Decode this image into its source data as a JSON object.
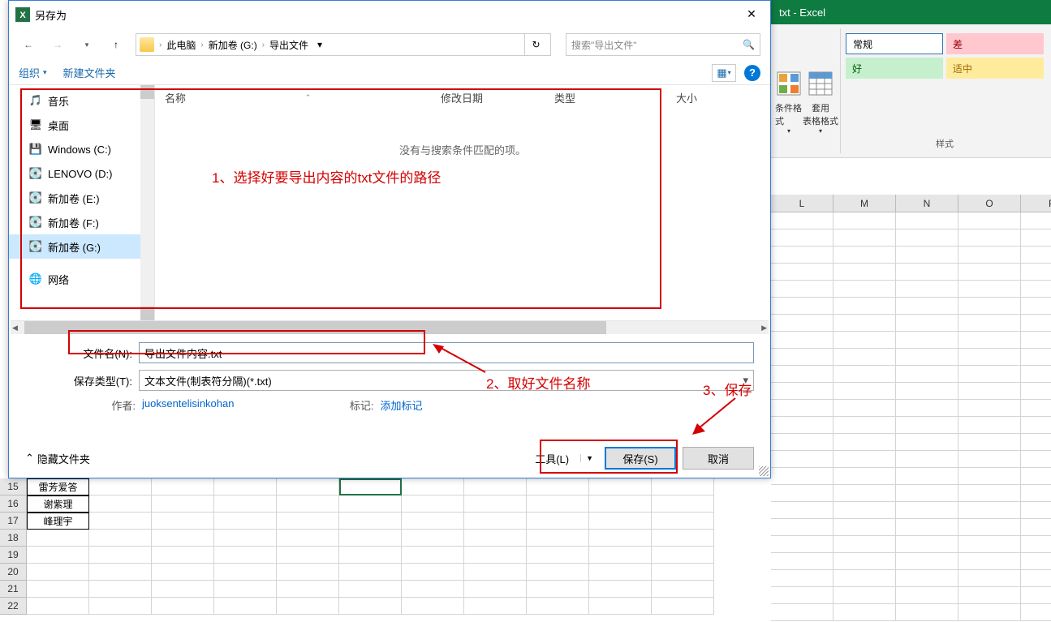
{
  "excel": {
    "title": "txt - Excel",
    "ribbon": {
      "cond_format": "条件格式",
      "table_format": "套用\n表格格式",
      "style_normal": "常规",
      "style_bad": "差",
      "style_good": "好",
      "style_mid": "适中",
      "group_label": "样式"
    },
    "col_headers": [
      "L",
      "M",
      "N",
      "O",
      "P"
    ],
    "rows": [
      {
        "num": "15",
        "val": "雷芳爱答"
      },
      {
        "num": "16",
        "val": "谢紫理"
      },
      {
        "num": "17",
        "val": "峰理宇"
      },
      {
        "num": "18",
        "val": ""
      },
      {
        "num": "19",
        "val": ""
      },
      {
        "num": "20",
        "val": ""
      },
      {
        "num": "21",
        "val": ""
      },
      {
        "num": "22",
        "val": ""
      }
    ]
  },
  "dialog": {
    "title": "另存为",
    "breadcrumb": {
      "pc": "此电脑",
      "drive": "新加卷 (G:)",
      "folder": "导出文件"
    },
    "search_placeholder": "搜索\"导出文件\"",
    "toolbar": {
      "organize": "组织",
      "new_folder": "新建文件夹"
    },
    "sidebar": [
      {
        "icon": "music",
        "label": "音乐"
      },
      {
        "icon": "desktop",
        "label": "桌面"
      },
      {
        "icon": "drive",
        "label": "Windows (C:)"
      },
      {
        "icon": "drive",
        "label": "LENOVO (D:)"
      },
      {
        "icon": "drive",
        "label": "新加卷 (E:)"
      },
      {
        "icon": "drive",
        "label": "新加卷 (F:)"
      },
      {
        "icon": "drive",
        "label": "新加卷 (G:)",
        "selected": true
      },
      {
        "icon": "network",
        "label": "网络"
      }
    ],
    "list": {
      "cols": {
        "name": "名称",
        "date": "修改日期",
        "type": "类型",
        "size": "大小"
      },
      "empty": "没有与搜索条件匹配的项。"
    },
    "form": {
      "filename_label": "文件名(N):",
      "filename_value": "导出文件内容.txt",
      "savetype_label": "保存类型(T):",
      "savetype_value": "文本文件(制表符分隔)(*.txt)",
      "author_label": "作者:",
      "author_value": "juoksentelisinkohan",
      "tag_label": "标记:",
      "tag_value": "添加标记"
    },
    "footer": {
      "hide_folders": "隐藏文件夹",
      "tools": "工具(L)",
      "save": "保存(S)",
      "cancel": "取消"
    }
  },
  "annotations": {
    "a1": "1、选择好要导出内容的txt文件的路径",
    "a2": "2、取好文件名称",
    "a3": "3、保存"
  }
}
